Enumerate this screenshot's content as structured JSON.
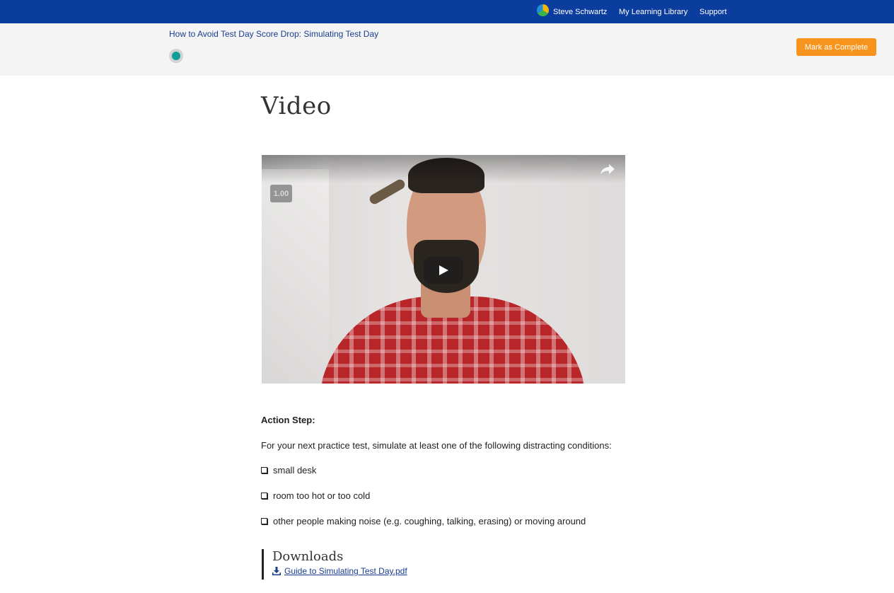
{
  "header": {
    "user_name": "Steve Schwartz",
    "nav_library": "My Learning Library",
    "nav_support": "Support"
  },
  "lesson": {
    "title": "How to Avoid Test Day Score Drop: Simulating Test Day",
    "complete_button": "Mark as Complete"
  },
  "main": {
    "heading": "Video",
    "video": {
      "speed_label": "1.00",
      "icons": [
        "share-icon",
        "play-icon"
      ]
    },
    "action_step": {
      "title": "Action Step:",
      "intro": "For your next practice test, simulate at least one of the following distracting conditions:",
      "conditions": [
        "small desk",
        "room too hot or too cold",
        "other people making noise (e.g. coughing, talking, erasing) or moving around"
      ]
    },
    "downloads": {
      "title": "Downloads",
      "file": "Guide to Simulating Test Day.pdf"
    }
  },
  "colors": {
    "topbar": "#0a3d9e",
    "accent_button": "#f7941d",
    "progress_dot": "#0f9e9a",
    "link": "#1a3d8f"
  }
}
